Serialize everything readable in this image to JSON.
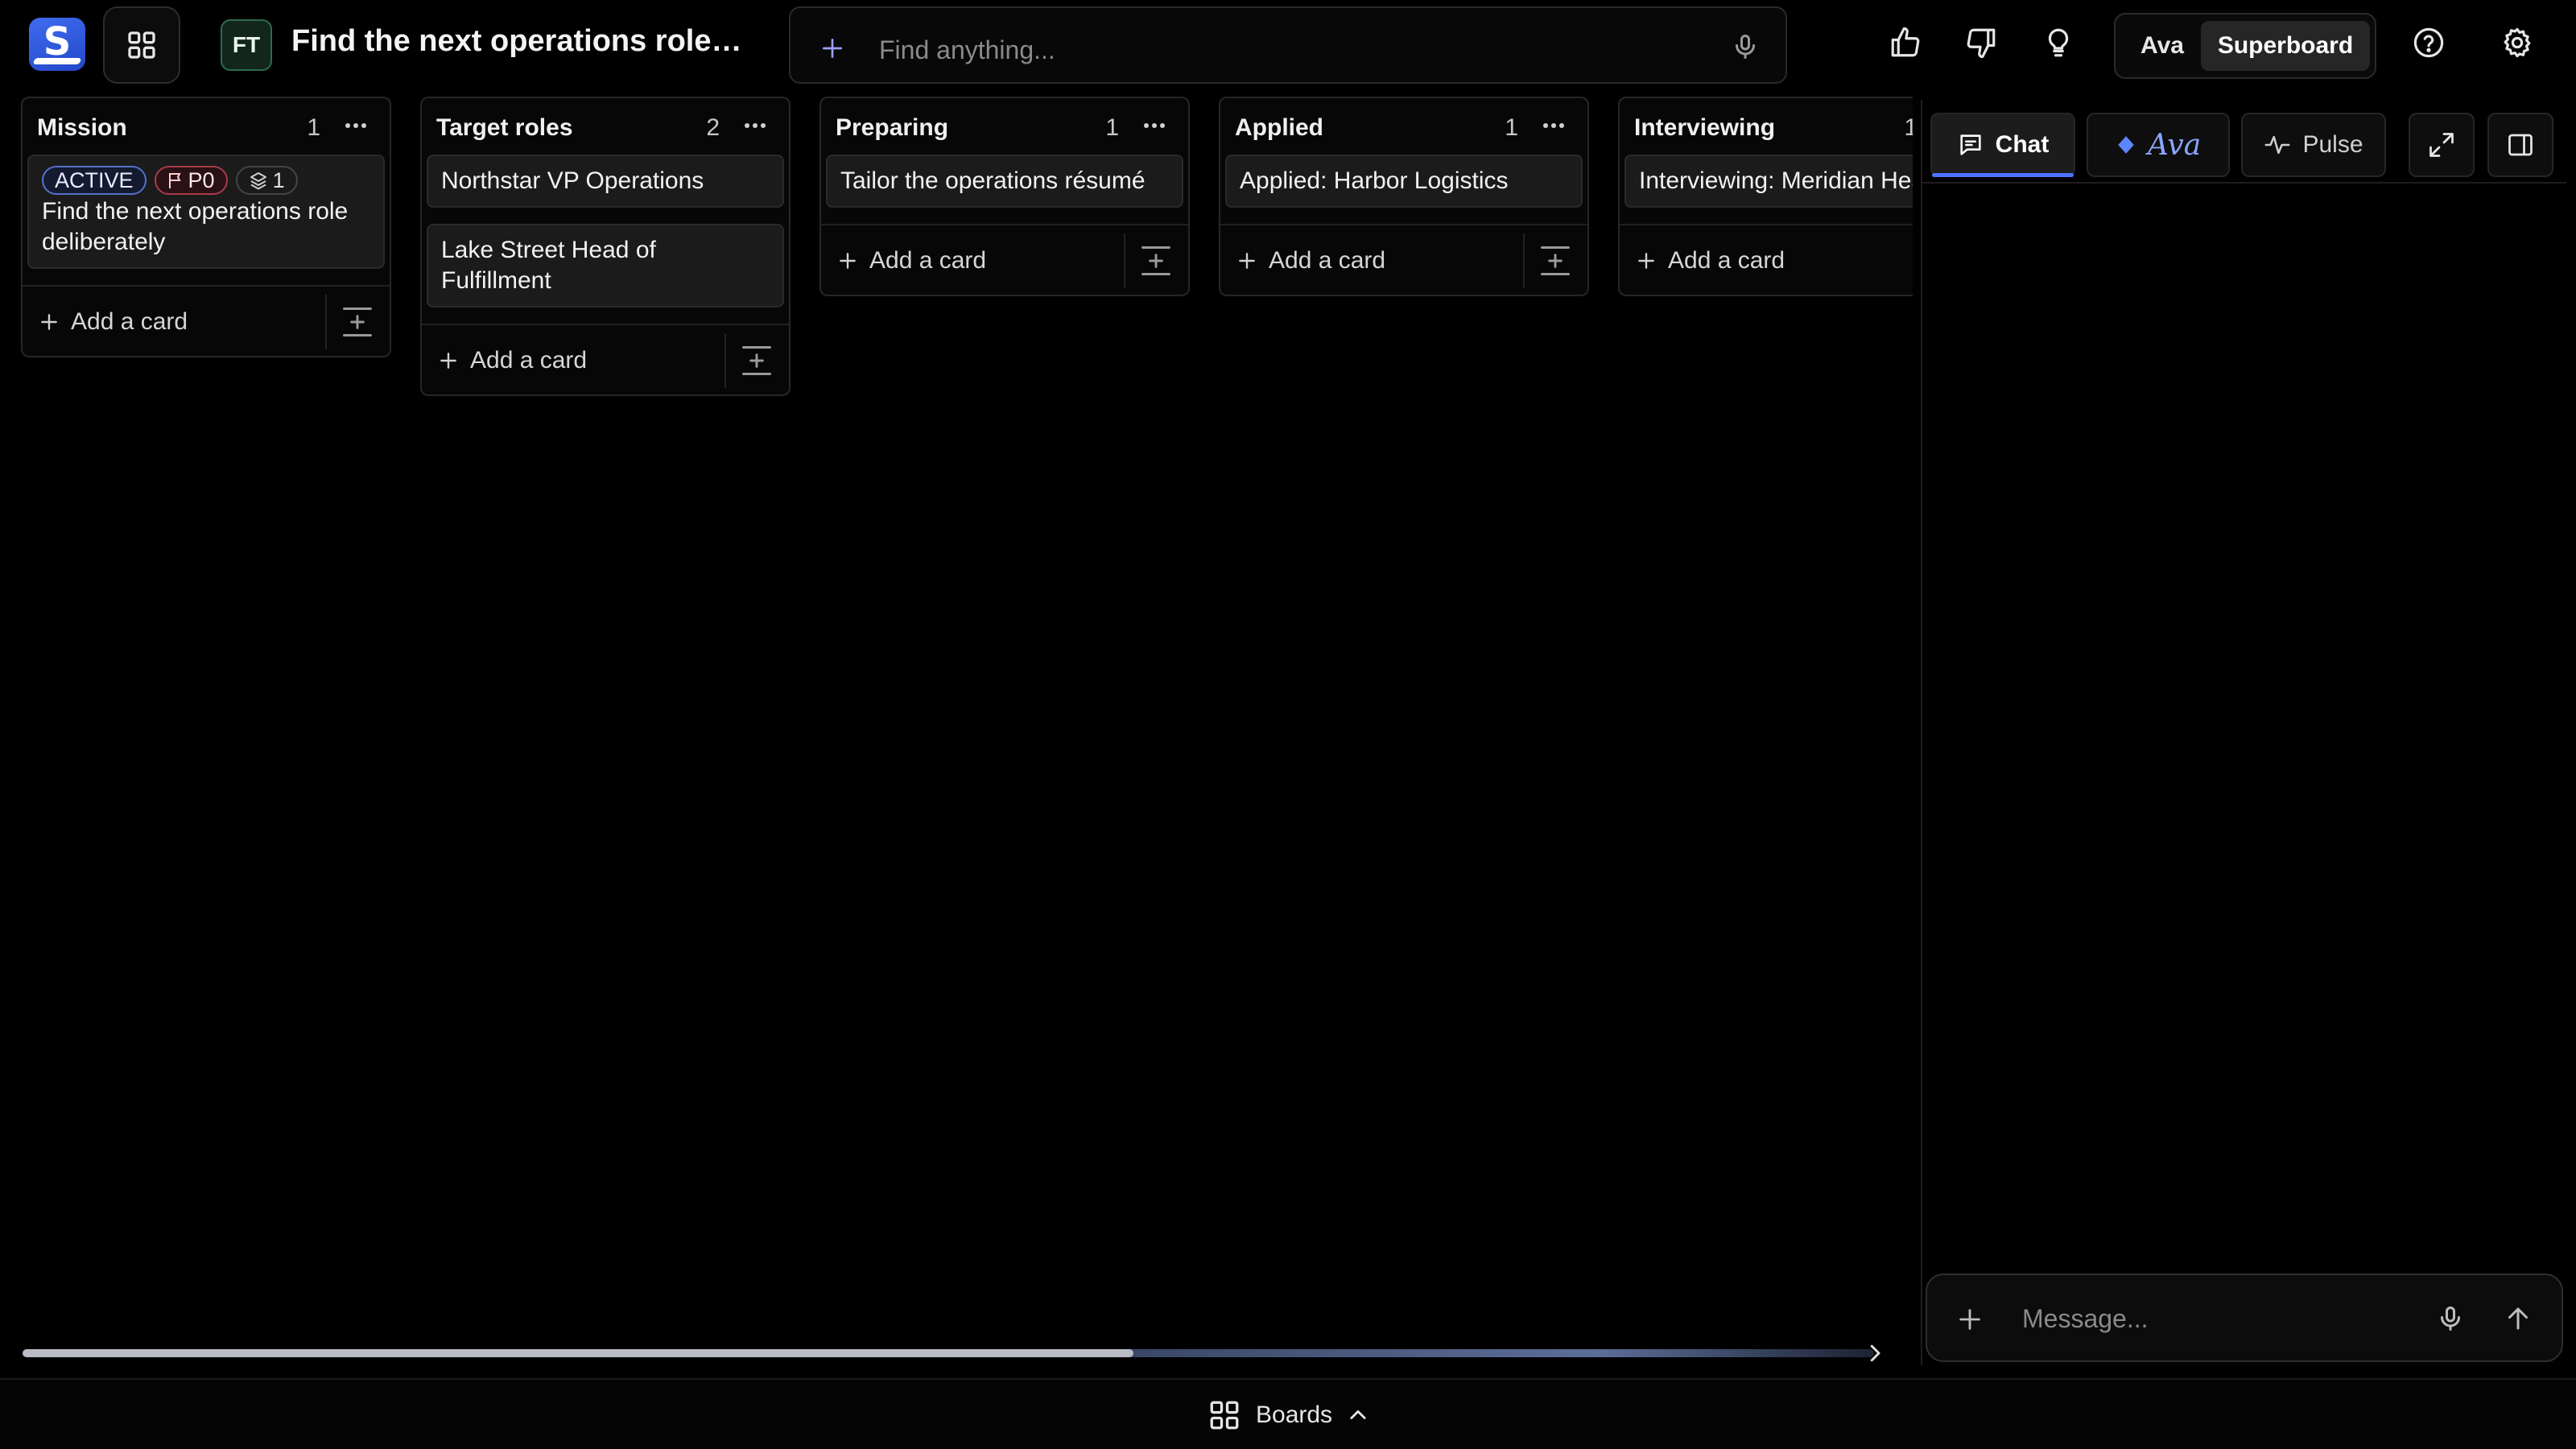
{
  "header": {
    "board_initials": "FT",
    "board_title": "Find the next operations role d...",
    "search_placeholder": "Find anything...",
    "mode_options": [
      "Ava",
      "Superboard"
    ],
    "active_mode": "Superboard"
  },
  "columns": [
    {
      "title": "Mission",
      "count": "1",
      "cards": [
        {
          "title": "Find the next operations role deliberately",
          "badges": {
            "status": "ACTIVE",
            "priority": "P0",
            "subtasks": "1"
          }
        }
      ],
      "add_label": "Add a card"
    },
    {
      "title": "Target roles",
      "count": "2",
      "cards": [
        {
          "title": "Northstar VP Operations"
        },
        {
          "title": "Lake Street Head of Fulfillment"
        }
      ],
      "add_label": "Add a card"
    },
    {
      "title": "Preparing",
      "count": "1",
      "cards": [
        {
          "title": "Tailor the operations résumé"
        }
      ],
      "add_label": "Add a card"
    },
    {
      "title": "Applied",
      "count": "1",
      "cards": [
        {
          "title": "Applied: Harbor Logistics"
        }
      ],
      "add_label": "Add a card"
    },
    {
      "title": "Interviewing",
      "count": "1",
      "cards": [
        {
          "title": "Interviewing: Meridian Health"
        }
      ],
      "add_label": "Add a card"
    }
  ],
  "panel": {
    "tabs": {
      "chat": "Chat",
      "ava": "Ava",
      "pulse": "Pulse"
    },
    "active_tab": "Chat",
    "message_placeholder": "Message..."
  },
  "dock": {
    "label": "Boards"
  },
  "colors": {
    "background": "#000000",
    "accent": "#4c73ff",
    "card": "#1b1b1b",
    "priority": "#a63d46"
  }
}
